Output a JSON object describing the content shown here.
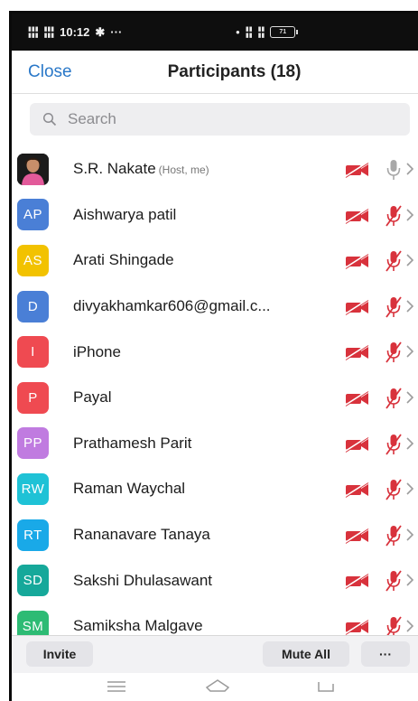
{
  "status_bar": {
    "time": "10:12",
    "extra_dots": "···",
    "battery_level": "71"
  },
  "header": {
    "close_label": "Close",
    "title": "Participants (18)"
  },
  "search": {
    "placeholder": "Search"
  },
  "participants": [
    {
      "initials": "",
      "name": "S.R. Nakate",
      "subtitle": "(Host, me)",
      "color": "#1a1a1a",
      "mic": "on",
      "photo": true
    },
    {
      "initials": "AP",
      "name": "Aishwarya patil",
      "subtitle": "",
      "color": "#4a7fd6",
      "mic": "muted"
    },
    {
      "initials": "AS",
      "name": "Arati Shingade",
      "subtitle": "",
      "color": "#f2c200",
      "mic": "muted"
    },
    {
      "initials": "D",
      "name": "divyakhamkar606@gmail.c...",
      "subtitle": "",
      "color": "#4a7fd6",
      "mic": "muted"
    },
    {
      "initials": "I",
      "name": "iPhone",
      "subtitle": "",
      "color": "#ef4a51",
      "mic": "muted"
    },
    {
      "initials": "P",
      "name": "Payal",
      "subtitle": "",
      "color": "#ef4a51",
      "mic": "muted"
    },
    {
      "initials": "PP",
      "name": "Prathamesh Parit",
      "subtitle": "",
      "color": "#c07be0",
      "mic": "muted"
    },
    {
      "initials": "RW",
      "name": "Raman Waychal",
      "subtitle": "",
      "color": "#1fc2d6",
      "mic": "muted"
    },
    {
      "initials": "RT",
      "name": "Rananavare Tanaya",
      "subtitle": "",
      "color": "#19a9e8",
      "mic": "muted"
    },
    {
      "initials": "SD",
      "name": "Sakshi Dhulasawant",
      "subtitle": "",
      "color": "#16a89a",
      "mic": "muted"
    },
    {
      "initials": "SM",
      "name": "Samiksha Malgave",
      "subtitle": "",
      "color": "#2dbb74",
      "mic": "muted"
    }
  ],
  "footer": {
    "invite_label": "Invite",
    "mute_all_label": "Mute All",
    "more_label": "···"
  },
  "colors": {
    "accent": "#2a78c8",
    "muted_red": "#d8323c"
  },
  "icons": [
    "search-icon",
    "video-off-icon",
    "mic-muted-icon",
    "mic-icon",
    "chevron-right-icon",
    "menu-icon",
    "home-icon",
    "back-icon"
  ]
}
